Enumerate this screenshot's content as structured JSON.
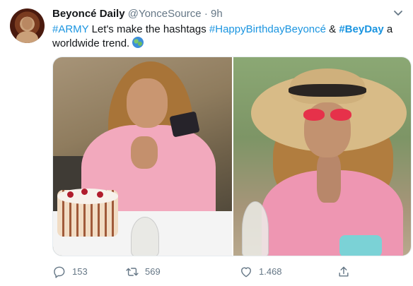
{
  "tweet": {
    "author_name": "Beyoncé Daily",
    "handle": "@YonceSource",
    "separator": "·",
    "time": "9h",
    "text_parts": {
      "tag_army": "#ARMY",
      "text1": " Let's make the hashtags ",
      "tag_birthday": "#HappyBirthdayBeyoncé",
      "text2": " & ",
      "tag_beyday": "#BeyDay",
      "text3": " a worldwide trend."
    },
    "emoji_icon": "globe-icon"
  },
  "actions": {
    "reply_count": "153",
    "retweet_count": "569",
    "like_count": "1.468",
    "reply_icon": "reply-icon",
    "retweet_icon": "retweet-icon",
    "like_icon": "heart-icon",
    "share_icon": "share-icon"
  },
  "colors": {
    "link": "#1b95e0",
    "text": "#14171a",
    "muted": "#657786"
  }
}
